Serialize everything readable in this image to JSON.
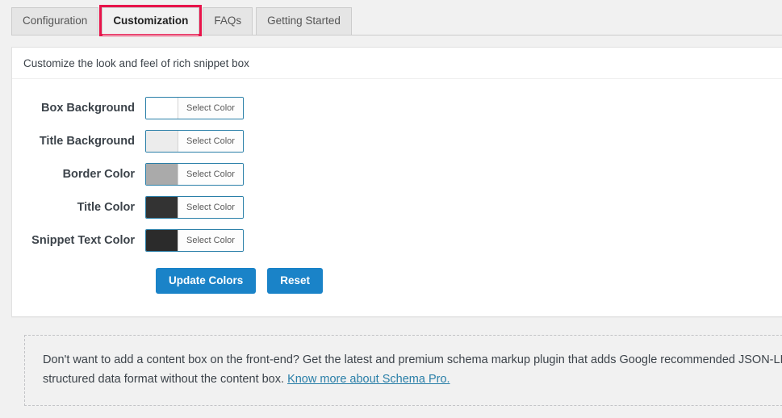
{
  "tabs": [
    {
      "label": "Configuration",
      "active": false
    },
    {
      "label": "Customization",
      "active": true
    },
    {
      "label": "FAQs",
      "active": false
    },
    {
      "label": "Getting Started",
      "active": false
    }
  ],
  "panel": {
    "header": "Customize the look and feel of rich snippet box",
    "fields": [
      {
        "label": "Box Background",
        "button": "Select Color",
        "color": "#ffffff"
      },
      {
        "label": "Title Background",
        "button": "Select Color",
        "color": "#ececec"
      },
      {
        "label": "Border Color",
        "button": "Select Color",
        "color": "#aaaaaa"
      },
      {
        "label": "Title Color",
        "button": "Select Color",
        "color": "#333333"
      },
      {
        "label": "Snippet Text Color",
        "button": "Select Color",
        "color": "#2b2b2b"
      }
    ],
    "actions": {
      "update_label": "Update Colors",
      "reset_label": "Reset"
    }
  },
  "notice": {
    "text_before_link": "Don't want to add a content box on the front-end? Get the latest and premium schema markup plugin that adds Google recommended JSON-LD structured data format without the content box. ",
    "link_label": "Know more about Schema Pro."
  },
  "colors": {
    "accent_blue": "#1a83c8",
    "active_tab_highlight": "#e8134a",
    "link_blue": "#2a7fa8"
  }
}
